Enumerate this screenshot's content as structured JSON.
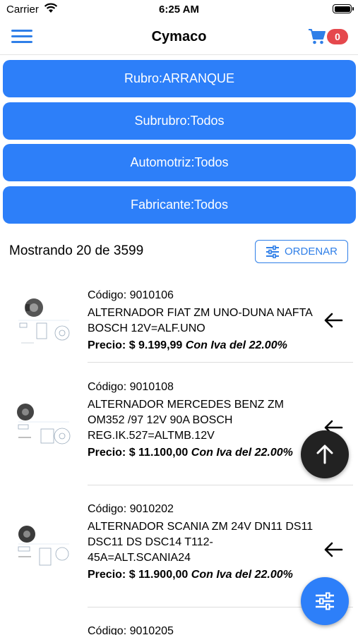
{
  "status_bar": {
    "carrier": "Carrier",
    "time": "6:25 AM"
  },
  "nav": {
    "title": "Cymaco",
    "cart_count": "0"
  },
  "filters": [
    {
      "label": "Rubro:ARRANQUE"
    },
    {
      "label": "Subrubro:Todos"
    },
    {
      "label": "Automotriz:Todos"
    },
    {
      "label": "Fabricante:Todos"
    }
  ],
  "results": {
    "count_text": "Mostrando 20 de 3599",
    "sort_label": "ORDENAR"
  },
  "products": [
    {
      "code": "Código: 9010106",
      "name": "ALTERNADOR FIAT ZM UNO-DUNA NAFTA BOSCH 12V=ALF.UNO",
      "price_label": "Precio: $ 9.199,99",
      "tax_note": "Con Iva del 22.00%"
    },
    {
      "code": "Código: 9010108",
      "name": "ALTERNADOR MERCEDES BENZ ZM OM352 /97 12V 90A BOSCH REG.IK.527=ALTMB.12V",
      "price_label": "Precio: $ 11.100,00",
      "tax_note": "Con Iva del 22.00%"
    },
    {
      "code": "Código: 9010202",
      "name": "ALTERNADOR SCANIA ZM 24V DN11 DS11 DSC11 DS DSC14 T112-45A=ALT.SCANIA24",
      "price_label": "Precio: $ 11.900,00",
      "tax_note": "Con Iva del 22.00%"
    },
    {
      "code": "Código: 9010205"
    }
  ],
  "colors": {
    "accent": "#2d7ff9",
    "badge": "#e5484d",
    "fab_dark": "#222222"
  },
  "icons": {
    "menu": "hamburger-icon",
    "cart": "cart-icon",
    "sort": "sliders-icon",
    "item_action": "arrow-left-icon",
    "scroll_top": "arrow-up-icon",
    "filter_fab": "sliders-icon"
  }
}
